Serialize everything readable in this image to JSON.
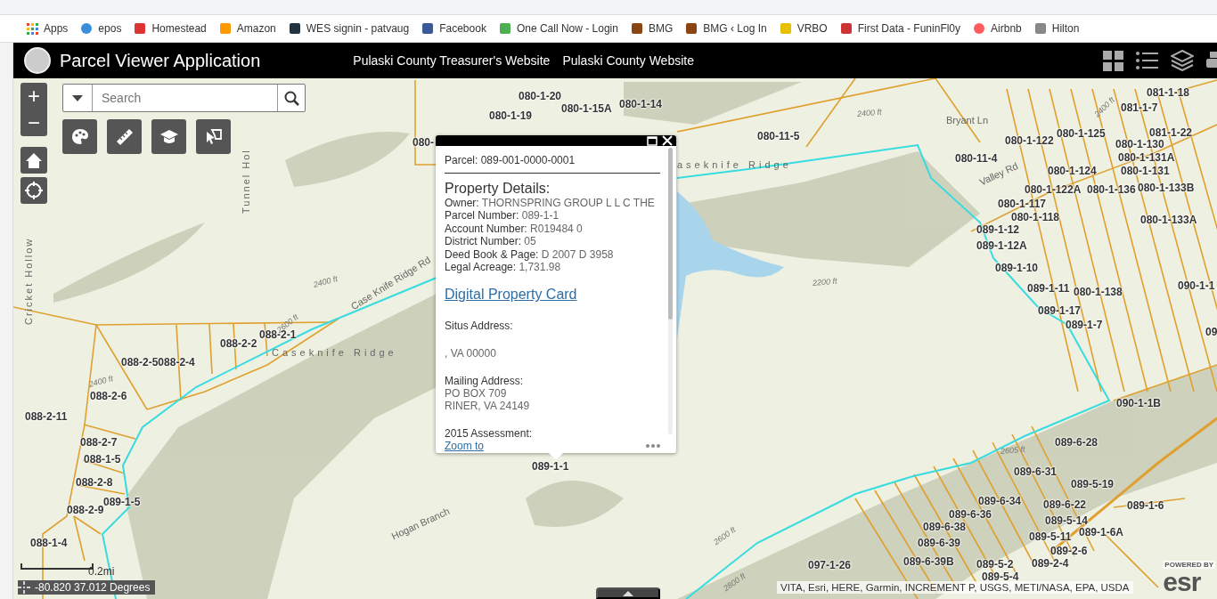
{
  "bookmarks": [
    {
      "label": "Apps"
    },
    {
      "label": "epos"
    },
    {
      "label": "Homestead"
    },
    {
      "label": "Amazon"
    },
    {
      "label": "WES signin - patvaug"
    },
    {
      "label": "Facebook"
    },
    {
      "label": "One Call Now - Login"
    },
    {
      "label": "BMG"
    },
    {
      "label": "BMG ‹ Log In"
    },
    {
      "label": "VRBO"
    },
    {
      "label": "First Data - FuninFl0y"
    },
    {
      "label": "Airbnb"
    },
    {
      "label": "Hilton"
    }
  ],
  "header": {
    "title": "Parcel Viewer Application",
    "links": [
      "Pulaski County Treasurer's Website",
      "Pulaski County Website"
    ]
  },
  "zoom_controls": [
    "+",
    "−"
  ],
  "search": {
    "placeholder": "Search"
  },
  "popup": {
    "parcel": "Parcel: 089-001-0000-0001",
    "section_title": "Property Details:",
    "fields": [
      {
        "label": "Owner:",
        "value": "THORNSPRING GROUP L L C THE"
      },
      {
        "label": "Parcel Number:",
        "value": "089-1-1"
      },
      {
        "label": "Account Number:",
        "value": "R019484 0"
      },
      {
        "label": "District Number:",
        "value": "05"
      },
      {
        "label": "Deed Book & Page:",
        "value": "D 2007 D 3958"
      },
      {
        "label": "Legal Acreage:",
        "value": "1,731.98"
      }
    ],
    "card_link": "Digital Property Card",
    "situs_label": "Situs Address:",
    "situs_value": ", VA 00000",
    "mailing_label": "Mailing Address:",
    "mailing_lines": [
      "PO BOX 709",
      "RINER, VA 24149"
    ],
    "assessment_label": "2015 Assessment:",
    "zoom_link": "Zoom to"
  },
  "map": {
    "parcels": [
      "080-1-20",
      "080-1-19",
      "080-1-15A",
      "080-1-14",
      "080-",
      "080-11-5",
      "080-11-4",
      "080-1-122",
      "080-1-125",
      "081-1-18",
      "081-1-7",
      "081-1-22",
      "080-1-130",
      "080-1-131A",
      "080-1-124",
      "080-1-131",
      "080-1-122A",
      "080-1-136",
      "080-1-133B",
      "080-1-117",
      "080-1-118",
      "080-1-133A",
      "089-1-12",
      "089-1-12A",
      "089-1-10",
      "089-1-11",
      "080-1-138",
      "090-1-1",
      "089-1-17",
      "089-1-7",
      "09",
      "090-1-1B",
      "089-6-28",
      "089-6-31",
      "089-5-19",
      "089-6-34",
      "089-6-22",
      "089-1-6",
      "089-6-36",
      "089-5-14",
      "089-6-38",
      "089-1-6A",
      "089-5-11",
      "089-6-39",
      "089-2-6",
      "097-1-26",
      "089-6-39B",
      "089-5-2",
      "089-2-4",
      "089-5-4",
      "088-2-2",
      "088-2-1",
      "088-2-5088-2-4",
      "088-2-6",
      "088-2-11",
      "088-2-7",
      "088-1-5",
      "088-2-8",
      "089-1-5",
      "088-2-9",
      "088-1-4",
      "089-1-1"
    ],
    "places": [
      "Tunnel Hol",
      "Cricket Hollow",
      "Caseknife Ridge",
      "Case Knife Ridge Rd",
      "aseknife Ridge",
      "Bryant Ln",
      "Valley Rd",
      "Hogan Branch"
    ],
    "contours": [
      "2400 ft",
      "2600 ft",
      "2400 ft",
      "2400 ft",
      "2200 ft",
      "2605 ft",
      "2600 ft",
      "2800 ft",
      "2400 ft"
    ]
  },
  "scale": "0.2mi",
  "coordinates": "-80.820 37.012 Degrees",
  "attribution": "VITA, Esri, HERE, Garmin, INCREMENT P, USGS, METI/NASA, EPA, USDA",
  "esri": {
    "powered": "POWERED BY",
    "logo": "esr"
  }
}
